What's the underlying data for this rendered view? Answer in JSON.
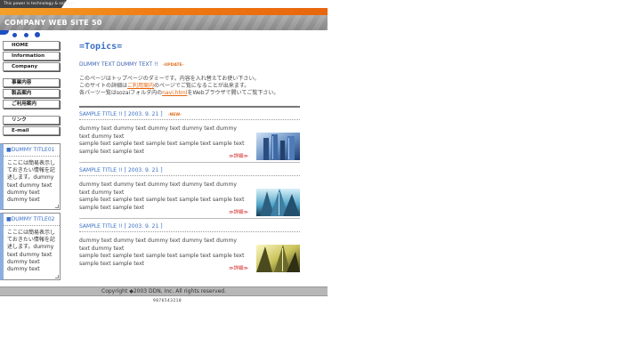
{
  "header": {
    "tagline": "This power is technology & solution",
    "site_title": "COMPANY WEB SITE 50"
  },
  "nav_group1": [
    "HOME",
    "Information",
    "Company"
  ],
  "nav_group2": [
    "事業内容",
    "製品案内",
    "ご利用案内"
  ],
  "nav_group3": [
    "リンク",
    "E-mail"
  ],
  "side_boxes": [
    {
      "title": "DUMMY TITLE01",
      "body": "ここには簡易表示しておきたい情報を記述します。dummy text dummy text dummy text dummy text"
    },
    {
      "title": "DUMMY TITLE02",
      "body": "ここには簡易表示しておきたい情報を記述します。dummy text dummy text dummy text dummy text"
    }
  ],
  "main": {
    "heading": "=Topics=",
    "intro_title": "DUMMY TEXT DUMMY TEXT !!",
    "update_badge": "-UPDATE-",
    "intro_line1": "このページはトップページのダミーです。内容を入れ替えてお使い下さい。",
    "intro_line2_pre": "このサイトの詳細は",
    "intro_line2_link": "ご利用案内",
    "intro_line2_post": "のページでご覧になることが出来ます。",
    "intro_line3_pre": "各パーツ一覧はsozaiフォルダ内の",
    "intro_line3_link": "navi.html",
    "intro_line3_post": "をWebブラウザで開いてご覧下さい。"
  },
  "articles": [
    {
      "title": "SAMPLE TITLE !! [ 2003. 9. 21 ]",
      "new_badge": "-NEW-",
      "line1": "dummy text dummy text dummy text dummy text dummy text dummy text",
      "line2": "sample text sample text sample text sample text sample text sample text sample text",
      "more": "≫詳細≫"
    },
    {
      "title": "SAMPLE TITLE !! [ 2003. 9. 21 ]",
      "new_badge": "",
      "line1": "dummy text dummy text dummy text dummy text dummy text dummy text",
      "line2": "sample text sample text sample text sample text sample text sample text sample text",
      "more": "≫詳細≫"
    },
    {
      "title": "SAMPLE TITLE !! [ 2003. 9. 21 ]",
      "new_badge": "",
      "line1": "dummy text dummy text dummy text dummy text dummy text dummy text",
      "line2": "sample text sample text sample text sample text sample text sample text sample text",
      "more": "≫詳細≫"
    }
  ],
  "footer": {
    "copyright": "Copyright ◆2003 DDN, Inc. All rights reserved.",
    "counter": "9876543210"
  },
  "colors": {
    "accent_orange": "#f07a12",
    "title_blue": "#3a6fc4",
    "link_orange": "#e8650c",
    "more_red": "#d02020",
    "header_gray": "#999999"
  }
}
